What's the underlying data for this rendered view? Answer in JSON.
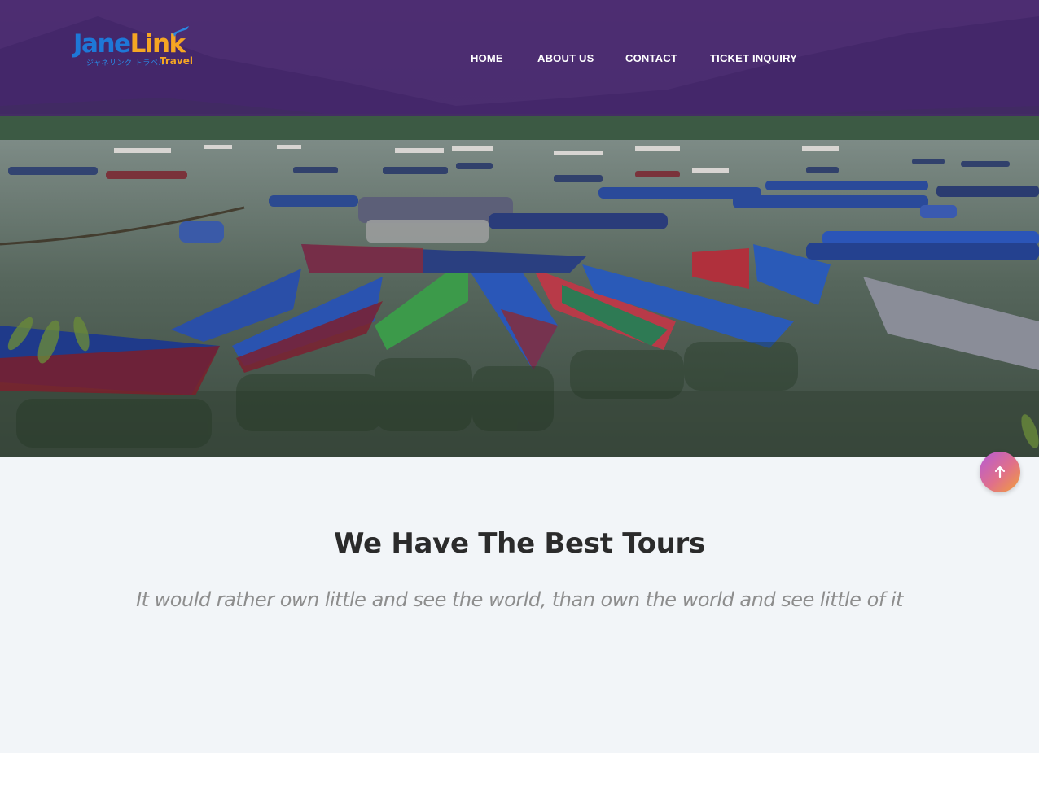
{
  "brand": {
    "name_part1": "Jane",
    "name_part2": "Link",
    "katakana": "ジャネリンク トラベル",
    "tagline": "Travel"
  },
  "nav": {
    "items": [
      {
        "label": "HOME"
      },
      {
        "label": "ABOUT US"
      },
      {
        "label": "CONTACT"
      },
      {
        "label": "TICKET INQUIRY"
      }
    ]
  },
  "section": {
    "title": "We Have The Best Tours",
    "subtitle": "It would rather own little and see the world, than own the world and see little of it"
  },
  "icons": {
    "scroll_top": "arrow-up-icon",
    "logo_mark": "airplane-icon"
  },
  "colors": {
    "header_overlay": "#46226e",
    "brand_blue": "#1e78d8",
    "brand_orange": "#f5a623",
    "section_background": "#f2f5f8",
    "title_color": "#2b2b2b",
    "subtitle_color": "#8d8d8d"
  }
}
